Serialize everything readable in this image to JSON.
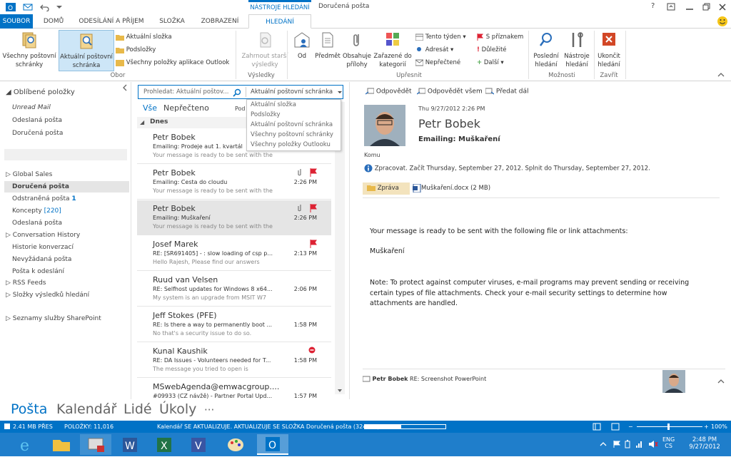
{
  "window": {
    "title": "Doručená pošta",
    "context": "NÁSTROJE HLEDÁNÍ",
    "help": "?"
  },
  "tabs": [
    "SOUBOR",
    "DOMŮ",
    "ODESÍLÁNÍ A PŘÍJEM",
    "SLOŽKA",
    "ZOBRAZENÍ",
    "HLEDÁNÍ"
  ],
  "ribbon": {
    "all_mailboxes": "Všechny poštovní schránky",
    "current_mailbox": "Aktuální poštovní schránka",
    "current_folder": "Aktuální složka",
    "subfolders": "Podsložky",
    "all_outlook": "Všechny položky aplikace Outlook",
    "scope_group": "Obor",
    "more_results": "Zahrnout starší výsledky",
    "results_group": "Výsledky",
    "from": "Od",
    "subject": "Předmět",
    "has_attachments": "Obsahuje přílohy",
    "categorized": "Zařazené do kategorií",
    "this_week": "Tento týden",
    "sent_to": "Adresát",
    "unread": "Nepřečtené",
    "flagged": "S příznakem",
    "important": "Důležité",
    "more": "Další",
    "refine_group": "Upřesnit",
    "recent": "Poslední hledání",
    "tools": "Nástroje hledání",
    "options_group": "Možnosti",
    "close_search": "Ukončit hledání",
    "close_group": "Zavřít"
  },
  "nav": {
    "favorites": "Oblíbené položky",
    "fav_items": [
      "Unread Mail",
      "Odeslaná pošta",
      "Doručená pošta"
    ],
    "items": [
      "Global Sales",
      "Doručená pošta",
      "Odstraněná pošta",
      "Koncepty",
      "Odeslaná pošta",
      "Conversation History",
      "Historie konverzací",
      "Nevyžádaná pošta",
      "Pošta k odeslání",
      "RSS Feeds",
      "Složky výsledků hledání",
      "Seznamy služby SharePoint"
    ],
    "deleted_count": "1",
    "drafts_count": "[220]"
  },
  "search": {
    "placeholder": "Prohledat: Aktuální poštov...",
    "scope": "Aktuální poštovní schránka",
    "dropdown": [
      "Aktuální složka",
      "Podsložky",
      "Aktuální poštovní schránka",
      "Všechny poštovní schránky",
      "Všechny položky Outlooku"
    ]
  },
  "filter": {
    "all": "Vše",
    "unread": "Nepřečteno",
    "by": "Pod"
  },
  "group_header": "Dnes",
  "mails": [
    {
      "name": "Petr Bobek",
      "subject": "Emailing: Prodeje aut 1. kvartál",
      "preview": "Your message is ready to be sent with the",
      "time": ""
    },
    {
      "name": "Petr Bobek",
      "subject": "Emailing: Cesta do cloudu",
      "preview": "Your message is ready to be sent with the",
      "time": "2:26 PM"
    },
    {
      "name": "Petr Bobek",
      "subject": "Emailing: Muškaření",
      "preview": "Your message is ready to be sent with the",
      "time": "2:26 PM"
    },
    {
      "name": "Josef Marek",
      "subject": "RE: [SR691405] - : slow loading of csp p...",
      "preview": "Hello Rajesh,  Please find our answers",
      "time": "2:13 PM"
    },
    {
      "name": "Ruud van Velsen",
      "subject": "RE: Selfhost updates for Windows 8 x64...",
      "preview": "My system is an upgrade from MSIT W7",
      "time": "2:06 PM"
    },
    {
      "name": "Jeff Stokes (PFE)",
      "subject": "RE: Is there a way to permanently boot ...",
      "preview": "No that's a security issue to do so.",
      "time": "1:58 PM"
    },
    {
      "name": "Kunal Kaushik",
      "subject": "RE: DA Issues - Volunteers needed for T...",
      "preview": "The message you tried to open is",
      "time": "1:58 PM"
    },
    {
      "name": "MSwebAgenda@emwacgroup....",
      "subject": "#09933 (CZ návžě) - Partner Portal Upd...",
      "preview": "",
      "time": "1:57 PM"
    }
  ],
  "reading": {
    "reply": "Odpovědět",
    "reply_all": "Odpovědět všem",
    "forward": "Předat dál",
    "date": "Thu 9/27/2012 2:26 PM",
    "sender": "Petr Bobek",
    "subject": "Emailing: Muškaření",
    "to_label": "Komu",
    "info": "Zpracovat.  Začít Thursday, September 27, 2012.  Splnit do Thursday, September 27, 2012.",
    "att_message": "Zpráva",
    "att_file": "Muškaření.docx (2 MB)",
    "body1": "Your message is ready to be sent with the following file or link attachments:",
    "body2": "Muškaření",
    "body3": "Note: To protect against computer viruses, e-mail programs may prevent sending or receiving certain types of file attachments.  Check your e-mail security settings to determine how attachments are handled.",
    "people_name": "Petr Bobek",
    "people_note": "RE: Screenshot PowerPoint"
  },
  "apps": [
    "Pošta",
    "Kalendář",
    "Lidé",
    "Úkoly",
    "···"
  ],
  "status": {
    "size": "2.41 MB PŘES",
    "items": "POLOŽKY: 11,016",
    "updating": "Kalendář SE AKTUALIZUJE.  AKTUALIZUJE SE SLOŽKA Doručená pošta (324 MB).",
    "progress": 0.45,
    "zoom": "100%"
  },
  "taskbar": {
    "lang1": "ENG",
    "lang2": "CS",
    "time": "2:48 PM",
    "date": "9/27/2012"
  }
}
